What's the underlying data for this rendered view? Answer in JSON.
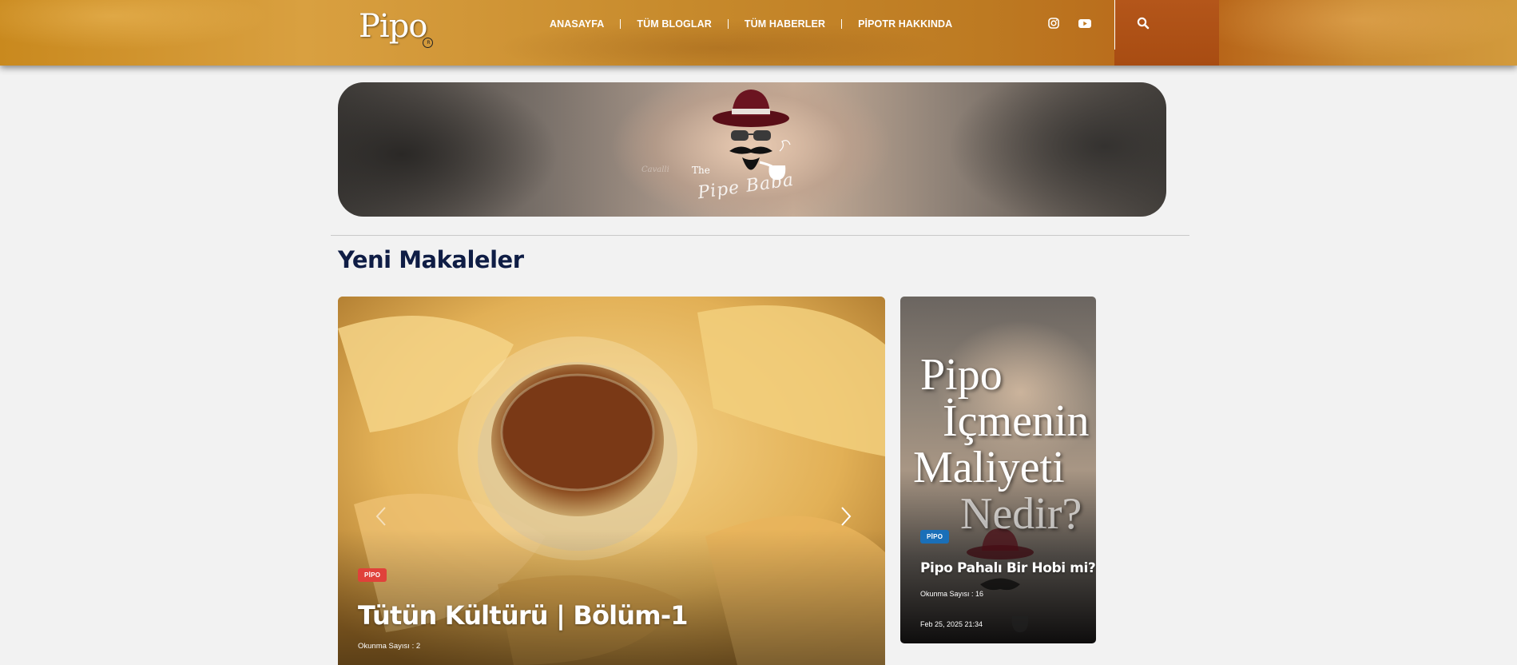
{
  "header": {
    "logo_text": "Pipo",
    "nav": [
      {
        "label": "ANASAYFA"
      },
      {
        "label": "TÜM BLOGLAR"
      },
      {
        "label": "TÜM HABERLER"
      },
      {
        "label": "PİPOTR HAKKINDA"
      }
    ],
    "icons": [
      "instagram-icon",
      "youtube-icon",
      "search-icon"
    ]
  },
  "banner": {
    "the": "The",
    "script": "Pipe Baba",
    "faint": "Cavalli"
  },
  "section": {
    "title": "Yeni Makaleler"
  },
  "main_article": {
    "category": "PİPO",
    "title": "Tütün Kültürü | Bölüm-1",
    "views": "Okunma Sayısı : 2"
  },
  "side_article": {
    "overlay_lines": [
      "Pipo",
      "İçmenin",
      "Maliyeti",
      "Nedir?"
    ],
    "category": "PİPO",
    "title": "Pipo Pahalı Bir Hobi mi?",
    "views": "Okunma Sayısı : 16",
    "date": "Feb 25, 2025 21:34"
  },
  "colors": {
    "header_orange": "#c78a2c",
    "title_navy": "#0f1d45",
    "badge_red": "#e0413a",
    "badge_blue": "#1a6fb8"
  }
}
